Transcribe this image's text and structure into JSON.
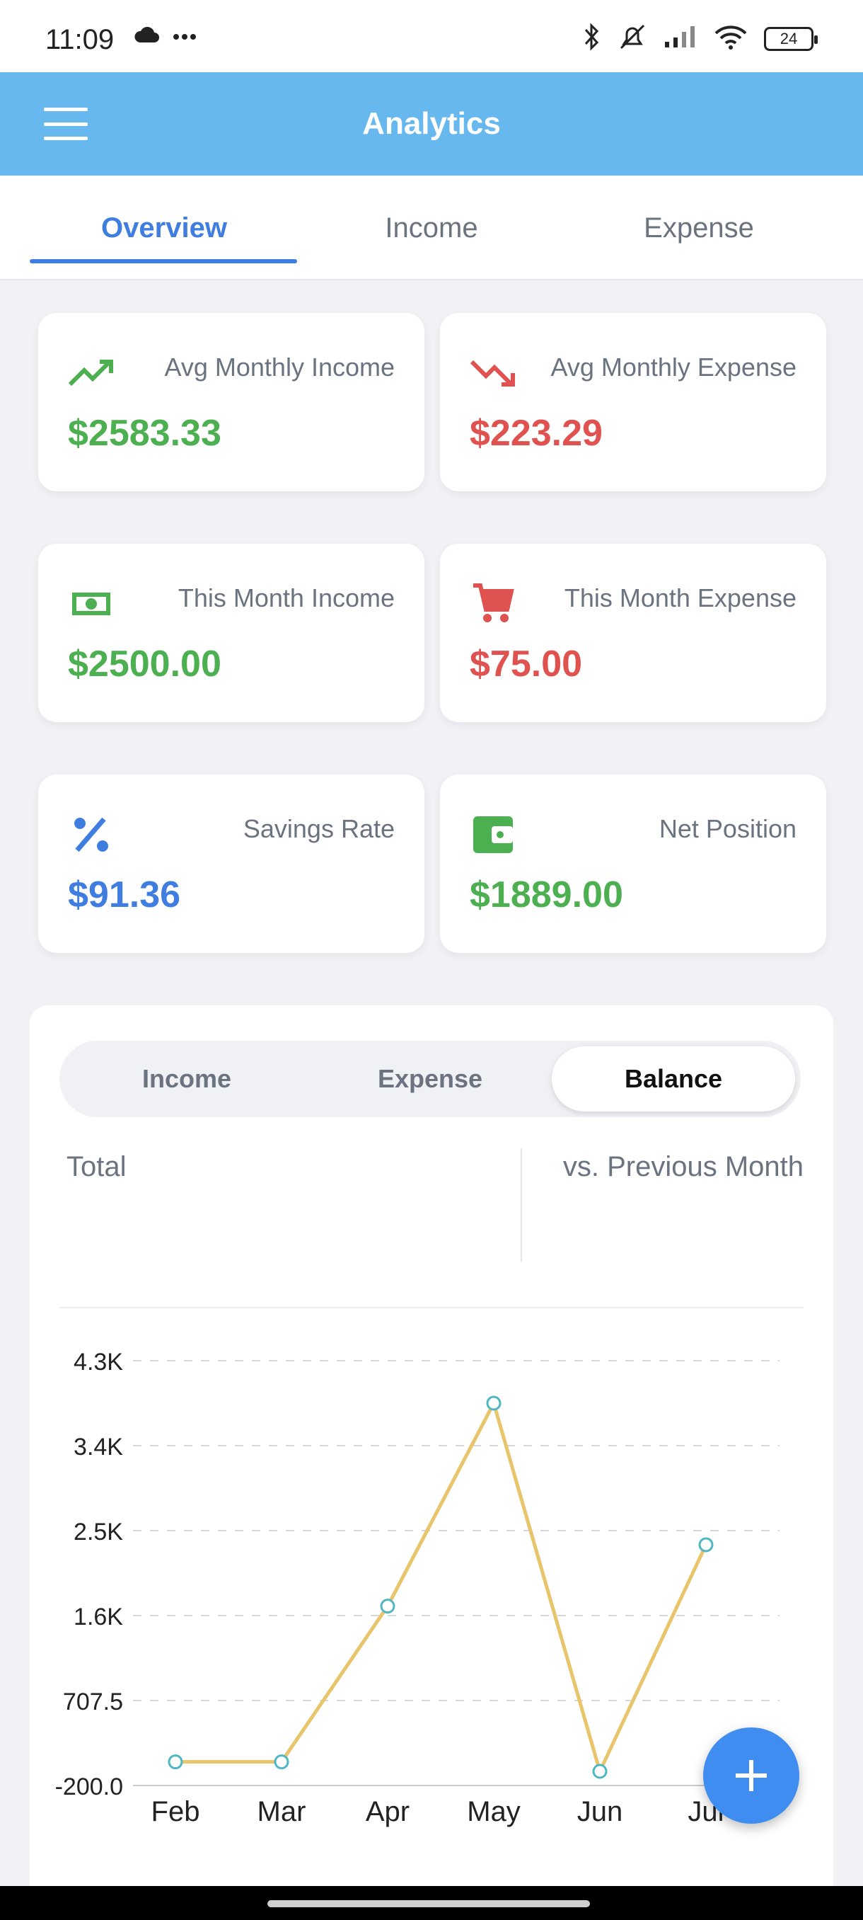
{
  "status_bar": {
    "time": "11:09",
    "battery": "24",
    "icons": [
      "cloud-icon",
      "more-dots-icon",
      "bluetooth-icon",
      "mute-icon",
      "signal-icon",
      "wifi-icon",
      "battery-icon"
    ]
  },
  "app_bar": {
    "title": "Analytics",
    "menu_icon": "hamburger-menu-icon"
  },
  "tabs": [
    {
      "label": "Overview",
      "active": true
    },
    {
      "label": "Income",
      "active": false
    },
    {
      "label": "Expense",
      "active": false
    }
  ],
  "stats": {
    "avg_income": {
      "label": "Avg Monthly Income",
      "value": "$2583.33",
      "icon": "trending-up-icon",
      "color": "#4caf50"
    },
    "avg_expense": {
      "label": "Avg Monthly Expense",
      "value": "$223.29",
      "icon": "trending-down-icon",
      "color": "#e0524f"
    },
    "month_income": {
      "label": "This Month Income",
      "value": "$2500.00",
      "icon": "cash-icon",
      "color": "#4caf50"
    },
    "month_expense": {
      "label": "This Month Expense",
      "value": "$75.00",
      "icon": "cart-icon",
      "color": "#e0524f"
    },
    "savings_rate": {
      "label": "Savings Rate",
      "value": "$91.36",
      "icon": "percent-icon",
      "color": "#3f7ee0"
    },
    "net_position": {
      "label": "Net Position",
      "value": "$1889.00",
      "icon": "wallet-icon",
      "color": "#4caf50"
    }
  },
  "chart_panel": {
    "segments": [
      {
        "label": "Income",
        "active": false
      },
      {
        "label": "Expense",
        "active": false
      },
      {
        "label": "Balance",
        "active": true
      }
    ],
    "summary_left": "Total",
    "summary_right": "vs. Previous Month"
  },
  "chart_data": {
    "type": "line",
    "categories": [
      "Feb",
      "Mar",
      "Apr",
      "May",
      "Jun",
      "Jul"
    ],
    "values": [
      50,
      50,
      1700,
      3850,
      -50,
      2350
    ],
    "y_ticks": [
      "4.3K",
      "3.4K",
      "2.5K",
      "1.6K",
      "707.5",
      "-200.0"
    ],
    "ylim": [
      -200,
      4300
    ],
    "grid": true,
    "line_color": "#e8c46a",
    "point_color": "#4fb6c4"
  },
  "fab": {
    "icon": "plus-icon"
  }
}
